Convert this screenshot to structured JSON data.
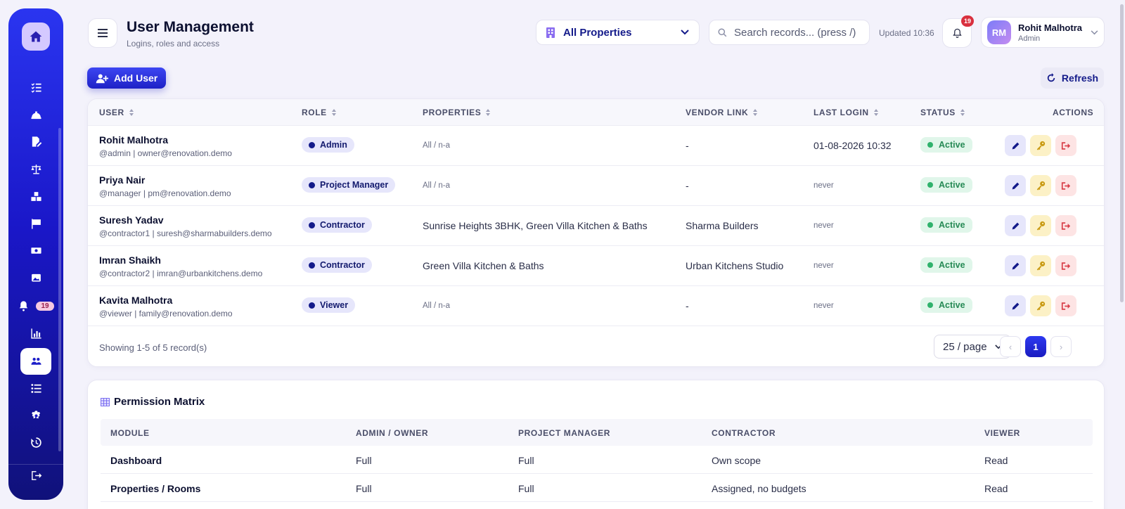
{
  "sidebar": {
    "badge": "19",
    "items": [
      {
        "icon": "tasks-icon"
      },
      {
        "icon": "hard-hat-icon"
      },
      {
        "icon": "file-edit-icon"
      },
      {
        "icon": "scale-icon"
      },
      {
        "icon": "boxes-icon"
      },
      {
        "icon": "flag-icon"
      },
      {
        "icon": "money-icon"
      },
      {
        "icon": "images-icon"
      },
      {
        "icon": "bell-icon"
      },
      {
        "icon": "chart-icon"
      },
      {
        "icon": "users-icon"
      },
      {
        "icon": "list-icon"
      },
      {
        "icon": "gear-icon"
      },
      {
        "icon": "history-icon"
      },
      {
        "icon": "logout-icon"
      }
    ]
  },
  "header": {
    "title": "User Management",
    "subtitle": "Logins, roles and access",
    "property_select": "All Properties",
    "search_placeholder": "Search records... (press /)",
    "updated": "Updated 10:36",
    "notifications": "19",
    "user": {
      "initials": "RM",
      "name": "Rohit Malhotra",
      "role": "Admin"
    }
  },
  "toolbar": {
    "add_label": "Add User",
    "refresh_label": "Refresh"
  },
  "users_table": {
    "columns": {
      "user": "USER",
      "role": "ROLE",
      "properties": "PROPERTIES",
      "vendor": "VENDOR LINK",
      "last_login": "LAST LOGIN",
      "status": "STATUS",
      "actions": "ACTIONS"
    },
    "rows": [
      {
        "name": "Rohit Malhotra",
        "sub": "@admin | owner@renovation.demo",
        "role": "Admin",
        "properties": "All / n-a",
        "properties_muted": true,
        "vendor": "-",
        "last_login": "01-08-2026 10:32",
        "login_muted": false,
        "status": "Active"
      },
      {
        "name": "Priya Nair",
        "sub": "@manager | pm@renovation.demo",
        "role": "Project Manager",
        "properties": "All / n-a",
        "properties_muted": true,
        "vendor": "-",
        "last_login": "never",
        "login_muted": true,
        "status": "Active"
      },
      {
        "name": "Suresh Yadav",
        "sub": "@contractor1 | suresh@sharmabuilders.demo",
        "role": "Contractor",
        "properties": "Sunrise Heights 3BHK, Green Villa Kitchen & Baths",
        "properties_muted": false,
        "vendor": "Sharma Builders",
        "last_login": "never",
        "login_muted": true,
        "status": "Active"
      },
      {
        "name": "Imran Shaikh",
        "sub": "@contractor2 | imran@urbankitchens.demo",
        "role": "Contractor",
        "properties": "Green Villa Kitchen & Baths",
        "properties_muted": false,
        "vendor": "Urban Kitchens Studio",
        "last_login": "never",
        "login_muted": true,
        "status": "Active"
      },
      {
        "name": "Kavita Malhotra",
        "sub": "@viewer | family@renovation.demo",
        "role": "Viewer",
        "properties": "All / n-a",
        "properties_muted": true,
        "vendor": "-",
        "last_login": "never",
        "login_muted": true,
        "status": "Active"
      }
    ],
    "footer": {
      "showing": "Showing 1-5 of 5 record(s)",
      "per_page": "25 / page",
      "prev": "‹",
      "page": "1",
      "next": "›"
    }
  },
  "permissions": {
    "title": "Permission Matrix",
    "columns": {
      "module": "MODULE",
      "admin": "ADMIN / OWNER",
      "pm": "PROJECT MANAGER",
      "contractor": "CONTRACTOR",
      "viewer": "VIEWER"
    },
    "rows": [
      {
        "module": "Dashboard",
        "admin": "Full",
        "pm": "Full",
        "contractor": "Own scope",
        "viewer": "Read"
      },
      {
        "module": "Properties / Rooms",
        "admin": "Full",
        "pm": "Full",
        "contractor": "Assigned, no budgets",
        "viewer": "Read"
      }
    ]
  },
  "colors": {
    "accent": "#1f22c6",
    "active": "#2fb26c",
    "badge": "#d9303e"
  }
}
